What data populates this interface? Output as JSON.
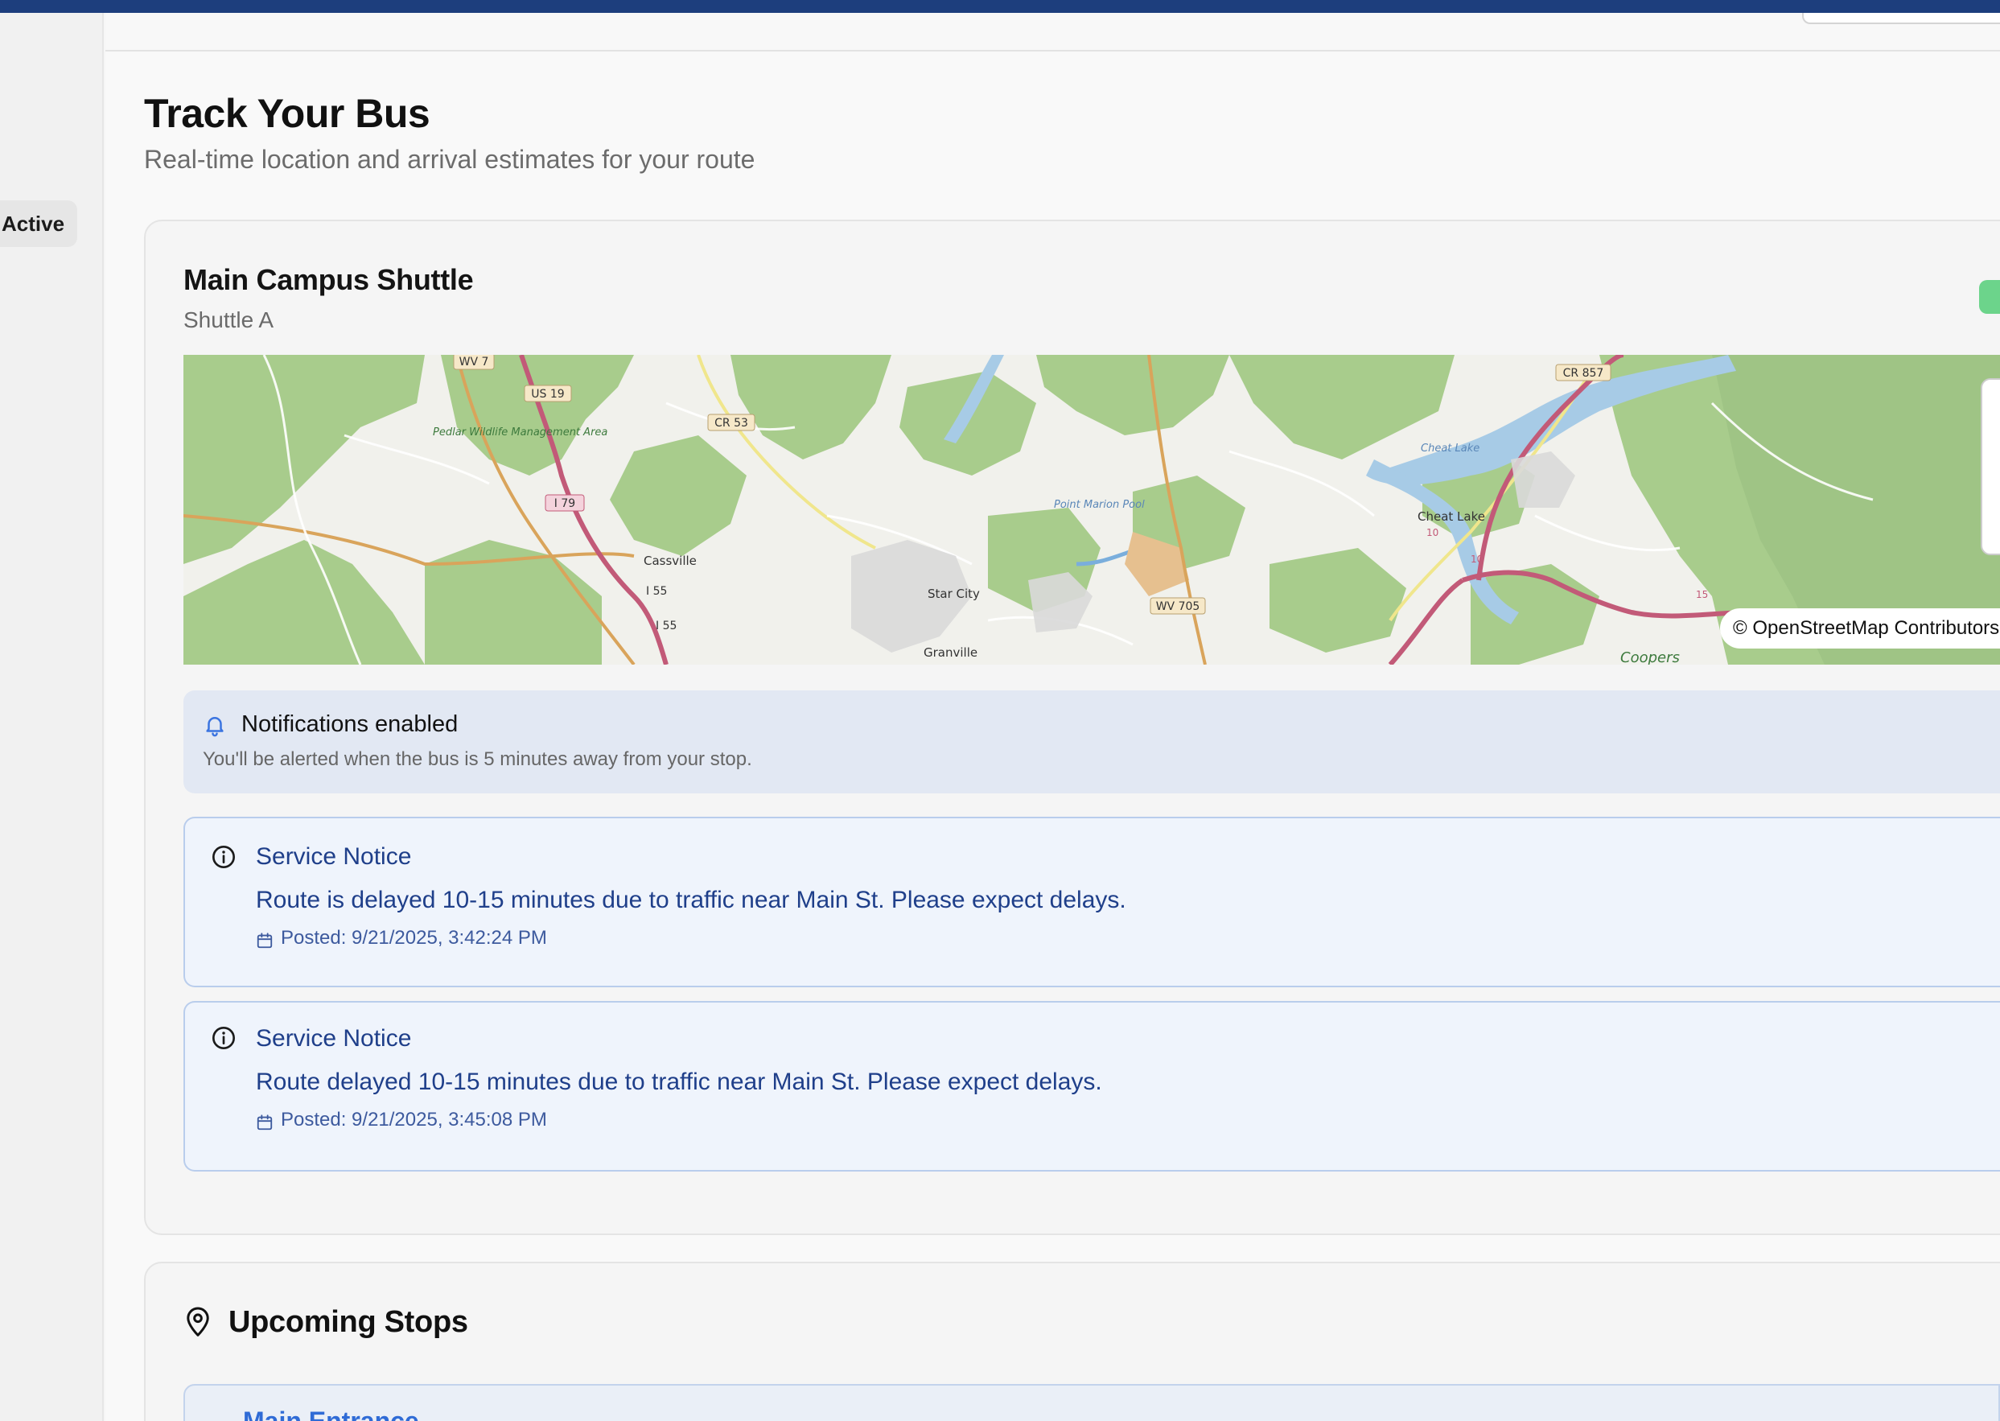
{
  "sidebar": {
    "status_badge": "Active"
  },
  "page": {
    "title": "Track Your Bus",
    "subtitle": "Real-time location and arrival estimates for your route"
  },
  "route_card": {
    "title": "Main Campus Shuttle",
    "subtitle": "Shuttle A",
    "map": {
      "attribution": "© OpenStreetMap Contributors",
      "labels": {
        "wv7": "WV 7",
        "us19": "US 19",
        "cr53": "CR 53",
        "cr857": "CR 857",
        "i79": "I 79",
        "i55a": "I 55",
        "i55b": "I 55",
        "wv705": "WV 705",
        "cassville": "Cassville",
        "star_city": "Star City",
        "granville": "Granville",
        "cheat_lake": "Cheat Lake",
        "cheat_lake_water": "Cheat Lake",
        "pedlar": "Pedlar Wildlife Management Area",
        "pool": "Point Marion Pool",
        "coopers": "Coopers",
        "r10a": "10",
        "r10b": "10",
        "r15": "15"
      }
    },
    "notification": {
      "icon": "bell-icon",
      "title": "Notifications enabled",
      "text": "You'll be alerted when the bus is 5 minutes away from your stop."
    },
    "notices": [
      {
        "title": "Service Notice",
        "text": "Route is delayed 10-15 minutes due to traffic near Main St. Please expect delays.",
        "posted": "Posted: 9/21/2025, 3:42:24 PM"
      },
      {
        "title": "Service Notice",
        "text": "Route delayed 10-15 minutes due to traffic near Main St. Please expect delays.",
        "posted": "Posted: 9/21/2025, 3:45:08 PM"
      }
    ]
  },
  "stops_card": {
    "title": "Upcoming Stops",
    "first_stop": "Main Entrance"
  },
  "colors": {
    "topbar": "#1d3e7d",
    "notice_text": "#1f3f8a",
    "notice_bg": "#eff4fc",
    "status_green": "#6cd48b"
  }
}
